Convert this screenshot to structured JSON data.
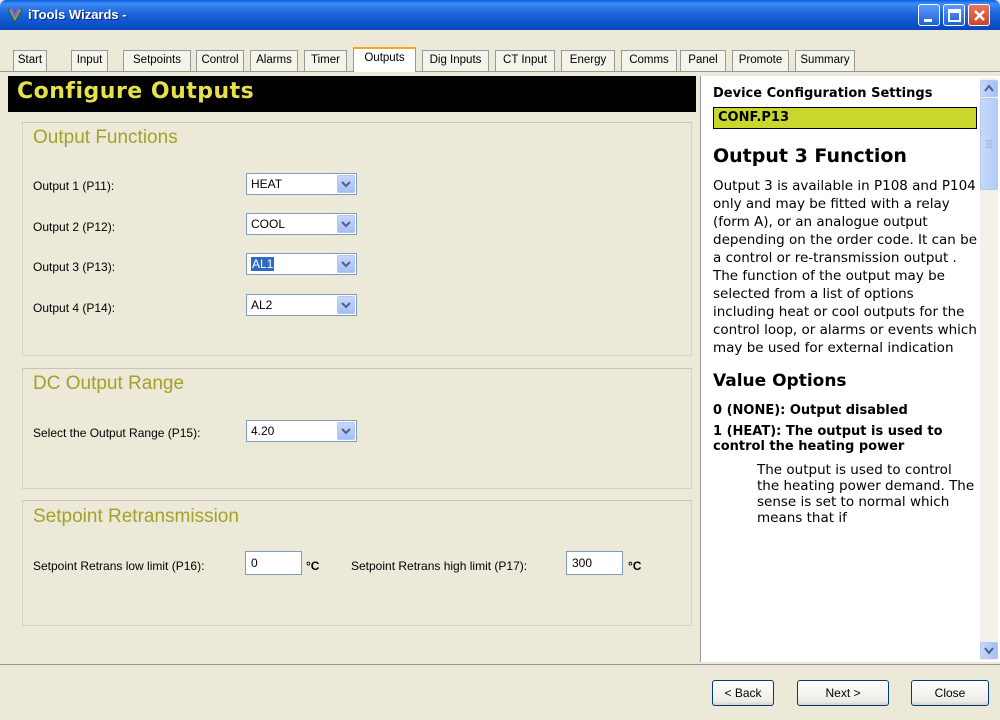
{
  "window": {
    "title": "iTools Wizards -",
    "icons": {
      "app": "itools-logo-icon",
      "min": "minimize-icon",
      "max": "maximize-icon",
      "close": "close-icon"
    }
  },
  "tabs": [
    {
      "label": "Start"
    },
    {
      "label": "Input"
    },
    {
      "label": "Setpoints"
    },
    {
      "label": "Control"
    },
    {
      "label": "Alarms"
    },
    {
      "label": "Timer"
    },
    {
      "label": "Outputs",
      "active": true
    },
    {
      "label": "Dig Inputs"
    },
    {
      "label": "CT Input"
    },
    {
      "label": "Energy"
    },
    {
      "label": "Comms"
    },
    {
      "label": "Panel"
    },
    {
      "label": "Promote"
    },
    {
      "label": "Summary"
    }
  ],
  "main": {
    "header": "Configure Outputs",
    "output_functions": {
      "title": "Output Functions",
      "rows": [
        {
          "label": "Output 1 (P11):",
          "value": "HEAT"
        },
        {
          "label": "Output 2 (P12):",
          "value": "COOL"
        },
        {
          "label": "Output 3 (P13):",
          "value": "AL1"
        },
        {
          "label": "Output 4 (P14):",
          "value": "AL2"
        }
      ]
    },
    "dc_output_range": {
      "title": "DC Output Range",
      "label": "Select the Output Range (P15):",
      "value": "4.20"
    },
    "setpoint_retrans": {
      "title": "Setpoint Retransmission",
      "low_label": "Setpoint Retrans low limit (P16):",
      "low_value": "0",
      "high_label": "Setpoint Retrans high limit (P17):",
      "high_value": "300",
      "unit": "°C"
    }
  },
  "help": {
    "heading": "Device Configuration Settings",
    "code": "CONF.P13",
    "title": "Output 3 Function",
    "paragraph": "Output 3 is available in P108 and P104 only and may be fitted with a relay (form A), or an analogue output depending on the order code. It can be a control or re-transmission output . The function of the output may be selected from a list of options including heat or cool outputs for the control loop, or alarms or events which may be used for external indication",
    "value_options_title": "Value Options",
    "option0": "0 (NONE): Output disabled",
    "option1": "1 (HEAT): The output is used to control the heating power",
    "option1_detail": "The output is used to control the heating power demand. The sense is set to normal which means that if"
  },
  "buttons": {
    "back": "< Back",
    "next": "Next >",
    "close": "Close"
  },
  "colors": {
    "header_band": "#000000",
    "header_text": "#E6E04A",
    "section_title": "#A3A128",
    "conf_box": "#C8D62E",
    "active_tab_accent": "#F5A623",
    "titlebar": "#0B4FC8"
  }
}
